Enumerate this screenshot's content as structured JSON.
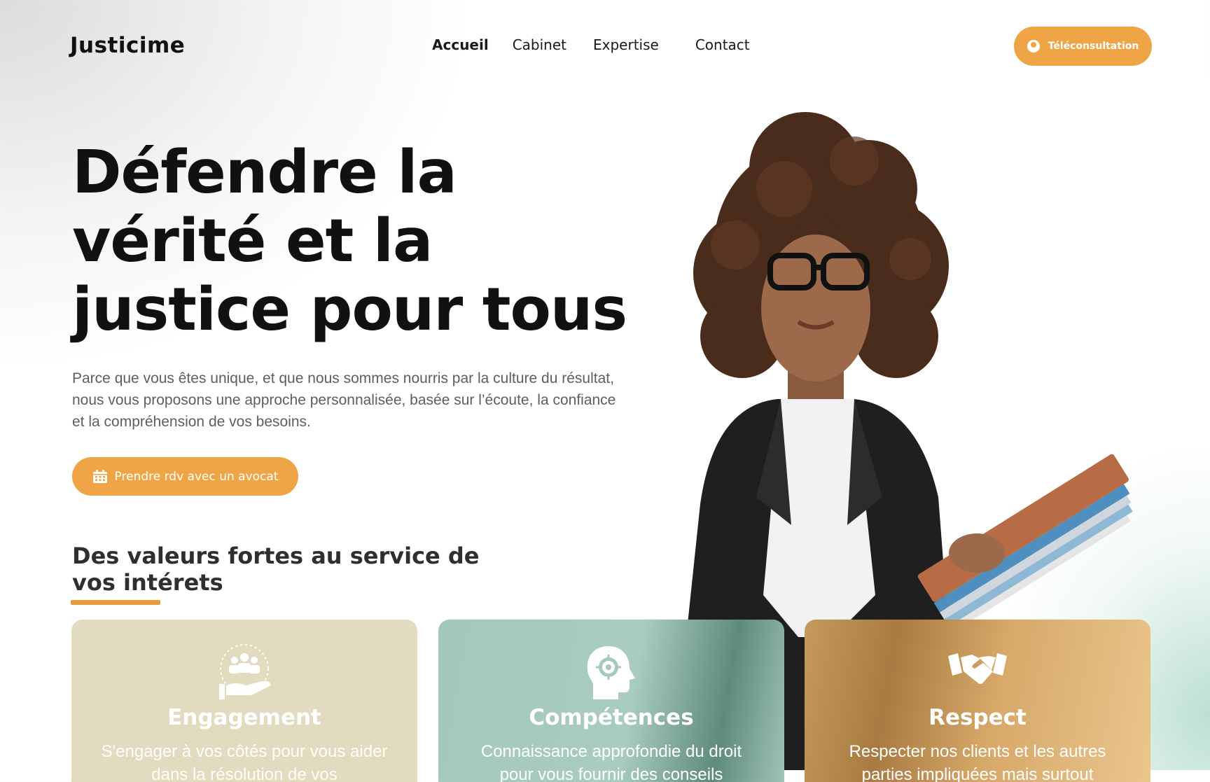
{
  "brand": {
    "logo": "Justicime"
  },
  "nav": {
    "items": [
      {
        "label": "Accueil",
        "active": true
      },
      {
        "label": "Cabinet"
      },
      {
        "label": "Expertise"
      },
      {
        "label": "Contact"
      }
    ]
  },
  "header": {
    "cta_label": "Téléconsultation",
    "cta_icon": "user-icon"
  },
  "hero": {
    "title": "Défendre la vérité et la justice pour tous",
    "text": "Parce que vous êtes unique, et que nous sommes nourris par la culture du résultat, nous vous proposons une approche personnalisée, basée sur l’écoute, la confiance et la compréhension de vos besoins.",
    "cta_label": "Prendre rdv avec un avocat",
    "cta_icon": "calendar-icon"
  },
  "values": {
    "title": "Des valeurs fortes au service de vos intérets",
    "cards": [
      {
        "title": "Engagement",
        "text": "S'engager à vos côtés pour vous aider dans la résolution de vos",
        "icon": "community-hand-icon"
      },
      {
        "title": "Compétences",
        "text": "Connaissance approfondie du droit pour vous fournir des conseils",
        "icon": "head-gear-icon"
      },
      {
        "title": "Respect",
        "text": "Respecter nos clients et les autres parties impliquées mais surtout",
        "icon": "handshake-icon"
      }
    ]
  },
  "colors": {
    "accent": "#efa545",
    "underline": "#e89c3c",
    "card1": "#e2dbbf",
    "card2": "#a4c8bb",
    "card3": "#c59a5c"
  }
}
